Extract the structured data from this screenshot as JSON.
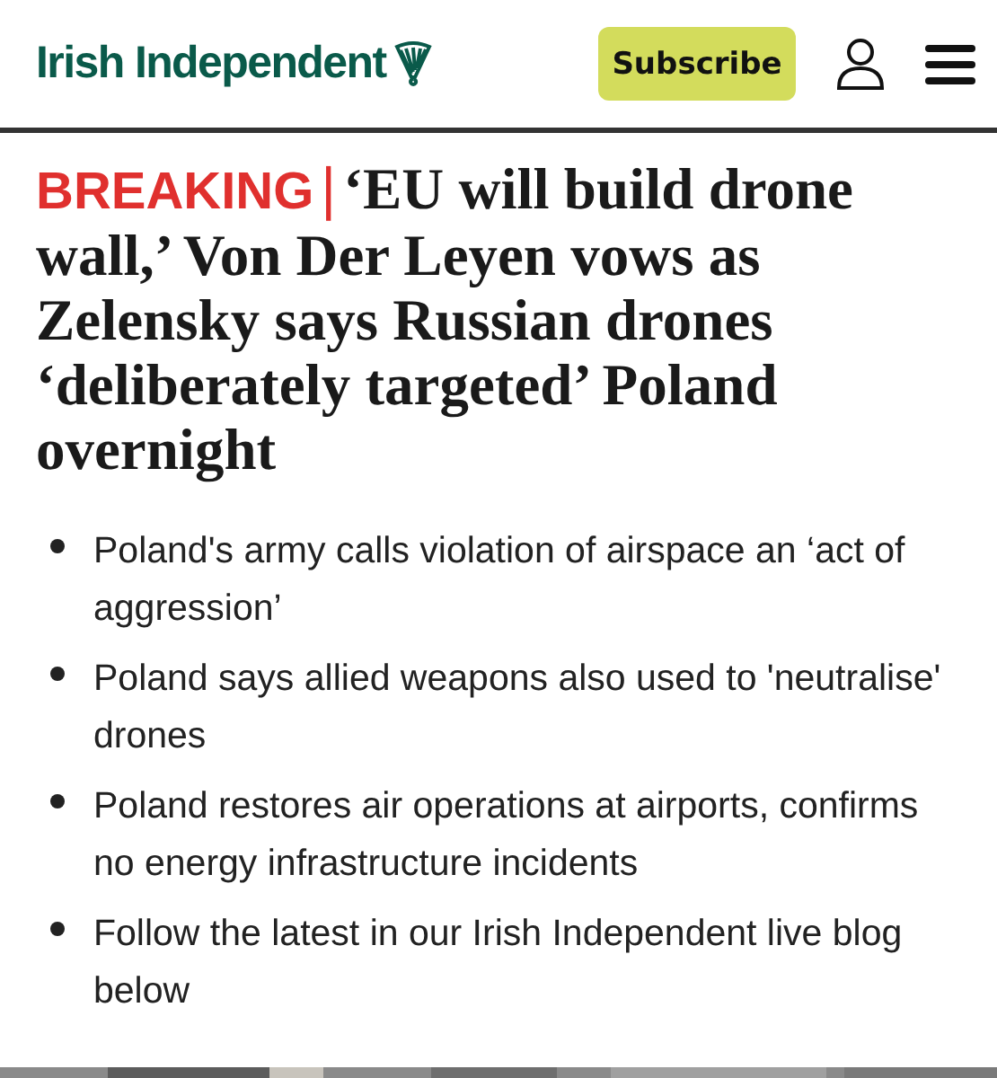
{
  "header": {
    "logo": "Irish Independent",
    "subscribe_button": "Subscribe"
  },
  "headline": {
    "label": "BREAKING",
    "separator": "|",
    "text": "‘EU will build drone wall,’ Von Der Leyen vows as Zelensky says Russian drones ‘deliberately targeted’ Poland overnight"
  },
  "bullets": [
    "Poland's army calls violation of airspace an ‘act of aggression’",
    "Poland says allied weapons also used to 'neutralise' drones",
    "Poland restores air operations at airports, confirms no energy infrastructure incidents",
    "Follow the latest in our Irish Independent live blog below"
  ]
}
